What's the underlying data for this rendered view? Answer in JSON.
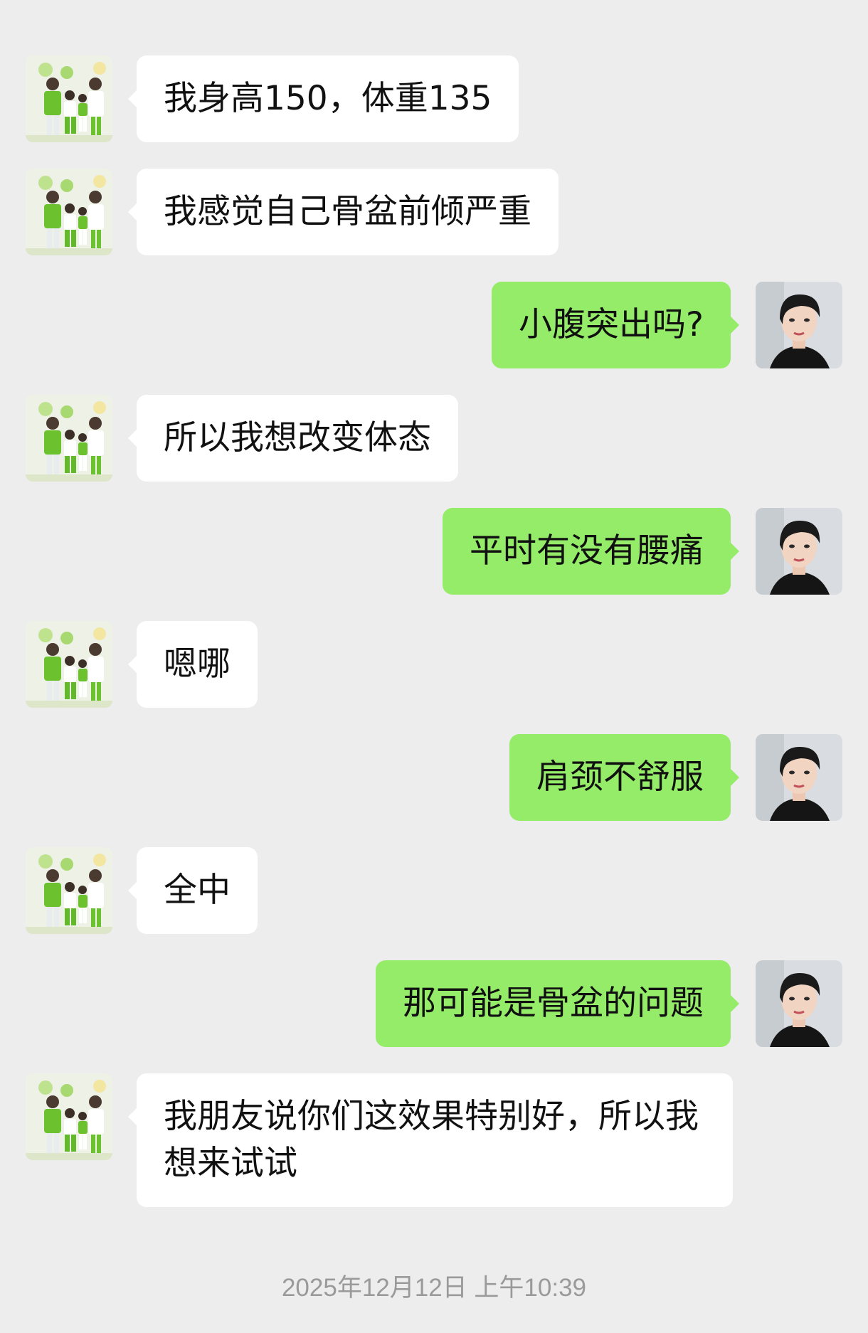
{
  "messages": [
    {
      "side": "in",
      "avatar": "family-photo-avatar",
      "text": "我身高150，体重135"
    },
    {
      "side": "in",
      "avatar": "family-photo-avatar",
      "text": "我感觉自己骨盆前倾严重"
    },
    {
      "side": "out",
      "avatar": "woman-portrait-avatar",
      "text": "小腹突出吗?"
    },
    {
      "side": "in",
      "avatar": "family-photo-avatar",
      "text": "所以我想改变体态"
    },
    {
      "side": "out",
      "avatar": "woman-portrait-avatar",
      "text": "平时有没有腰痛"
    },
    {
      "side": "in",
      "avatar": "family-photo-avatar",
      "text": "嗯哪"
    },
    {
      "side": "out",
      "avatar": "woman-portrait-avatar",
      "text": "肩颈不舒服"
    },
    {
      "side": "in",
      "avatar": "family-photo-avatar",
      "text": "全中"
    },
    {
      "side": "out",
      "avatar": "woman-portrait-avatar",
      "text": "那可能是骨盆的问题"
    },
    {
      "side": "in",
      "avatar": "family-photo-avatar",
      "text": "我朋友说你们这效果特别好，所以我想来试试"
    }
  ],
  "timestamp": "2025年12月12日 上午10:39",
  "colors": {
    "background": "#ededed",
    "incoming_bubble": "#ffffff",
    "outgoing_bubble": "#95ec69",
    "timestamp_text": "#9a9a9a"
  }
}
